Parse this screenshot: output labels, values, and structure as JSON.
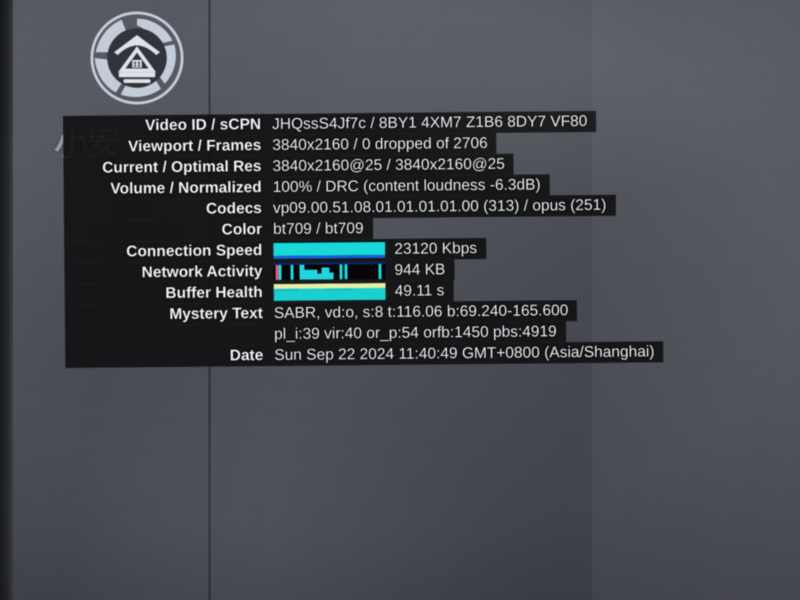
{
  "logo": {
    "icon": "aperture-house-logo"
  },
  "watermark": {
    "text": "小安"
  },
  "stats": {
    "rows": [
      {
        "label": "Video ID / sCPN",
        "value": "JHQssS4Jf7c / 8BY1 4XM7 Z1B6 8DY7 VF80"
      },
      {
        "label": "Viewport / Frames",
        "value": "3840x2160 / 0 dropped of 2706"
      },
      {
        "label": "Current / Optimal Res",
        "value": "3840x2160@25 / 3840x2160@25"
      },
      {
        "label": "Volume / Normalized",
        "value": "100% / DRC (content loudness -6.3dB)"
      },
      {
        "label": "Codecs",
        "value": "vp09.00.51.08.01.01.01.01.00 (313) / opus (251)"
      },
      {
        "label": "Color",
        "value": "bt709 / bt709"
      }
    ],
    "graphs": [
      {
        "label": "Connection Speed",
        "value": "23120 Kbps",
        "graph": "connection-speed-graph"
      },
      {
        "label": "Network Activity",
        "value": "944 KB",
        "graph": "network-activity-graph"
      },
      {
        "label": "Buffer Health",
        "value": "49.11 s",
        "graph": "buffer-health-graph"
      }
    ],
    "mystery": {
      "label": "Mystery Text",
      "line1": "SABR, vd:o, s:8 t:116.06 b:69.240-165.600",
      "line2": "pl_i:39 vir:40 or_p:54 orfb:1450 pbs:4919"
    },
    "date": {
      "label": "Date",
      "value": "Sun Sep 22 2024 11:40:49 GMT+0800 (Asia/Shanghai)"
    }
  },
  "colors": {
    "panel_bg": "#121214",
    "text": "#eef0f2",
    "cyan": "#18d8d8",
    "blue": "#1560d8",
    "pink": "#e8507f",
    "pale_green": "#e4efa8",
    "screen_bg": "#4a4c54"
  }
}
